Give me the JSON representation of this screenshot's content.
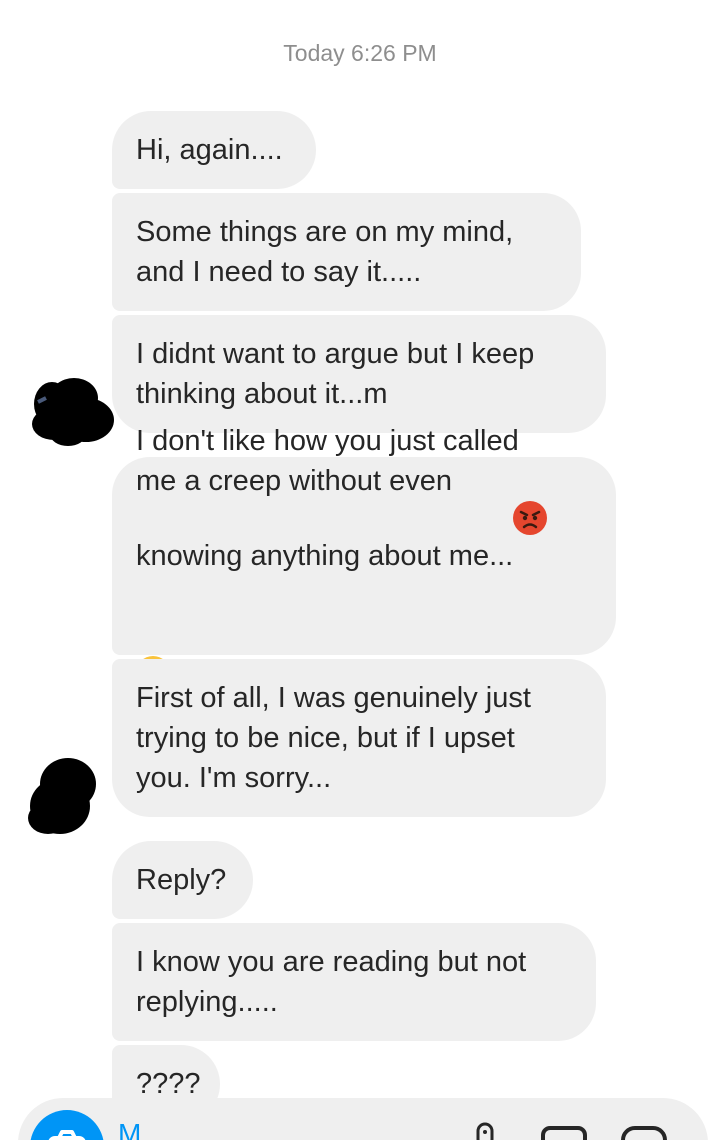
{
  "thread": {
    "timestamp": "Today 6:26 PM",
    "messages": [
      {
        "text": "Hi, again...."
      },
      {
        "text": "Some things are on my mind,\nand I need to say it....."
      },
      {
        "text": "I didnt want to argue but I keep\nthinking about it...m"
      },
      {
        "text": "I don't like how you just called\nme a creep without even\nknowing anything about me...",
        "emojis": [
          "angry-face",
          "unamused-face"
        ]
      },
      {
        "text": "First of all, I was genuinely just\ntrying to be nice, but if I upset\nyou. I'm sorry..."
      },
      {
        "text": "Reply?"
      },
      {
        "text": "I know you are reading but not\nreplying....."
      },
      {
        "text": "????"
      }
    ]
  },
  "composer": {
    "partial_text": "M",
    "icons": [
      "camera-icon",
      "microphone-icon",
      "image-icon",
      "sticker-icon"
    ],
    "accent": "#0095f6"
  },
  "colors": {
    "bubble": "#efefef",
    "timestamp": "#8e8e8e",
    "text": "#262626"
  }
}
